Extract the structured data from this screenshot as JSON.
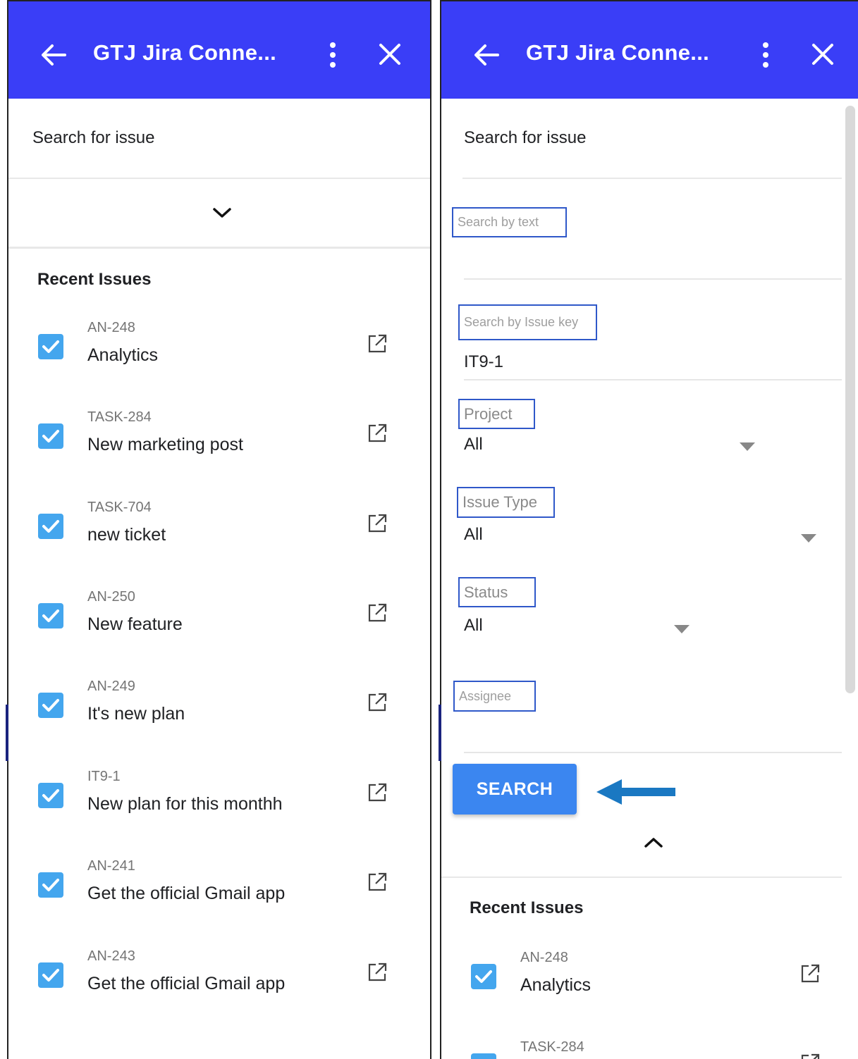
{
  "app": {
    "title": "GTJ Jira Conne...",
    "bar_color": "#3a3ef7"
  },
  "left_panel": {
    "search_section_label": "Search for issue",
    "recent_heading": "Recent Issues",
    "issues": [
      {
        "key": "AN-248",
        "name": "Analytics",
        "checked": true
      },
      {
        "key": "TASK-284",
        "name": "New marketing post",
        "checked": true
      },
      {
        "key": "TASK-704",
        "name": "new ticket",
        "checked": true
      },
      {
        "key": "AN-250",
        "name": "New feature",
        "checked": true
      },
      {
        "key": "AN-249",
        "name": "It's new plan",
        "checked": true
      },
      {
        "key": "IT9-1",
        "name": "New plan for this monthh",
        "checked": true
      },
      {
        "key": "AN-241",
        "name": "Get the official Gmail app",
        "checked": true
      },
      {
        "key": "AN-243",
        "name": "Get the official Gmail app",
        "checked": true
      }
    ]
  },
  "right_panel": {
    "search_section_label": "Search for issue",
    "fields": {
      "text": {
        "placeholder": "Search by text",
        "value": ""
      },
      "issue_key": {
        "placeholder": "Search by Issue key",
        "value": "IT9-1"
      },
      "project": {
        "label": "Project",
        "value": "All"
      },
      "issue_type": {
        "label": "Issue Type",
        "value": "All"
      },
      "status": {
        "label": "Status",
        "value": "All"
      },
      "assignee": {
        "placeholder": "Assignee",
        "value": ""
      }
    },
    "search_button": "SEARCH",
    "recent_heading": "Recent Issues",
    "issues": [
      {
        "key": "AN-248",
        "name": "Analytics",
        "checked": true
      },
      {
        "key": "TASK-284",
        "name": "",
        "checked": true
      }
    ]
  },
  "icons": {
    "back": "arrow-left-icon",
    "menu": "more-vertical-icon",
    "close": "close-icon",
    "expand": "chevron-down-icon",
    "collapse": "chevron-up-icon",
    "open": "external-link-icon",
    "check": "checkbox-checked-icon",
    "annotation": "blue-arrow-left-icon"
  }
}
